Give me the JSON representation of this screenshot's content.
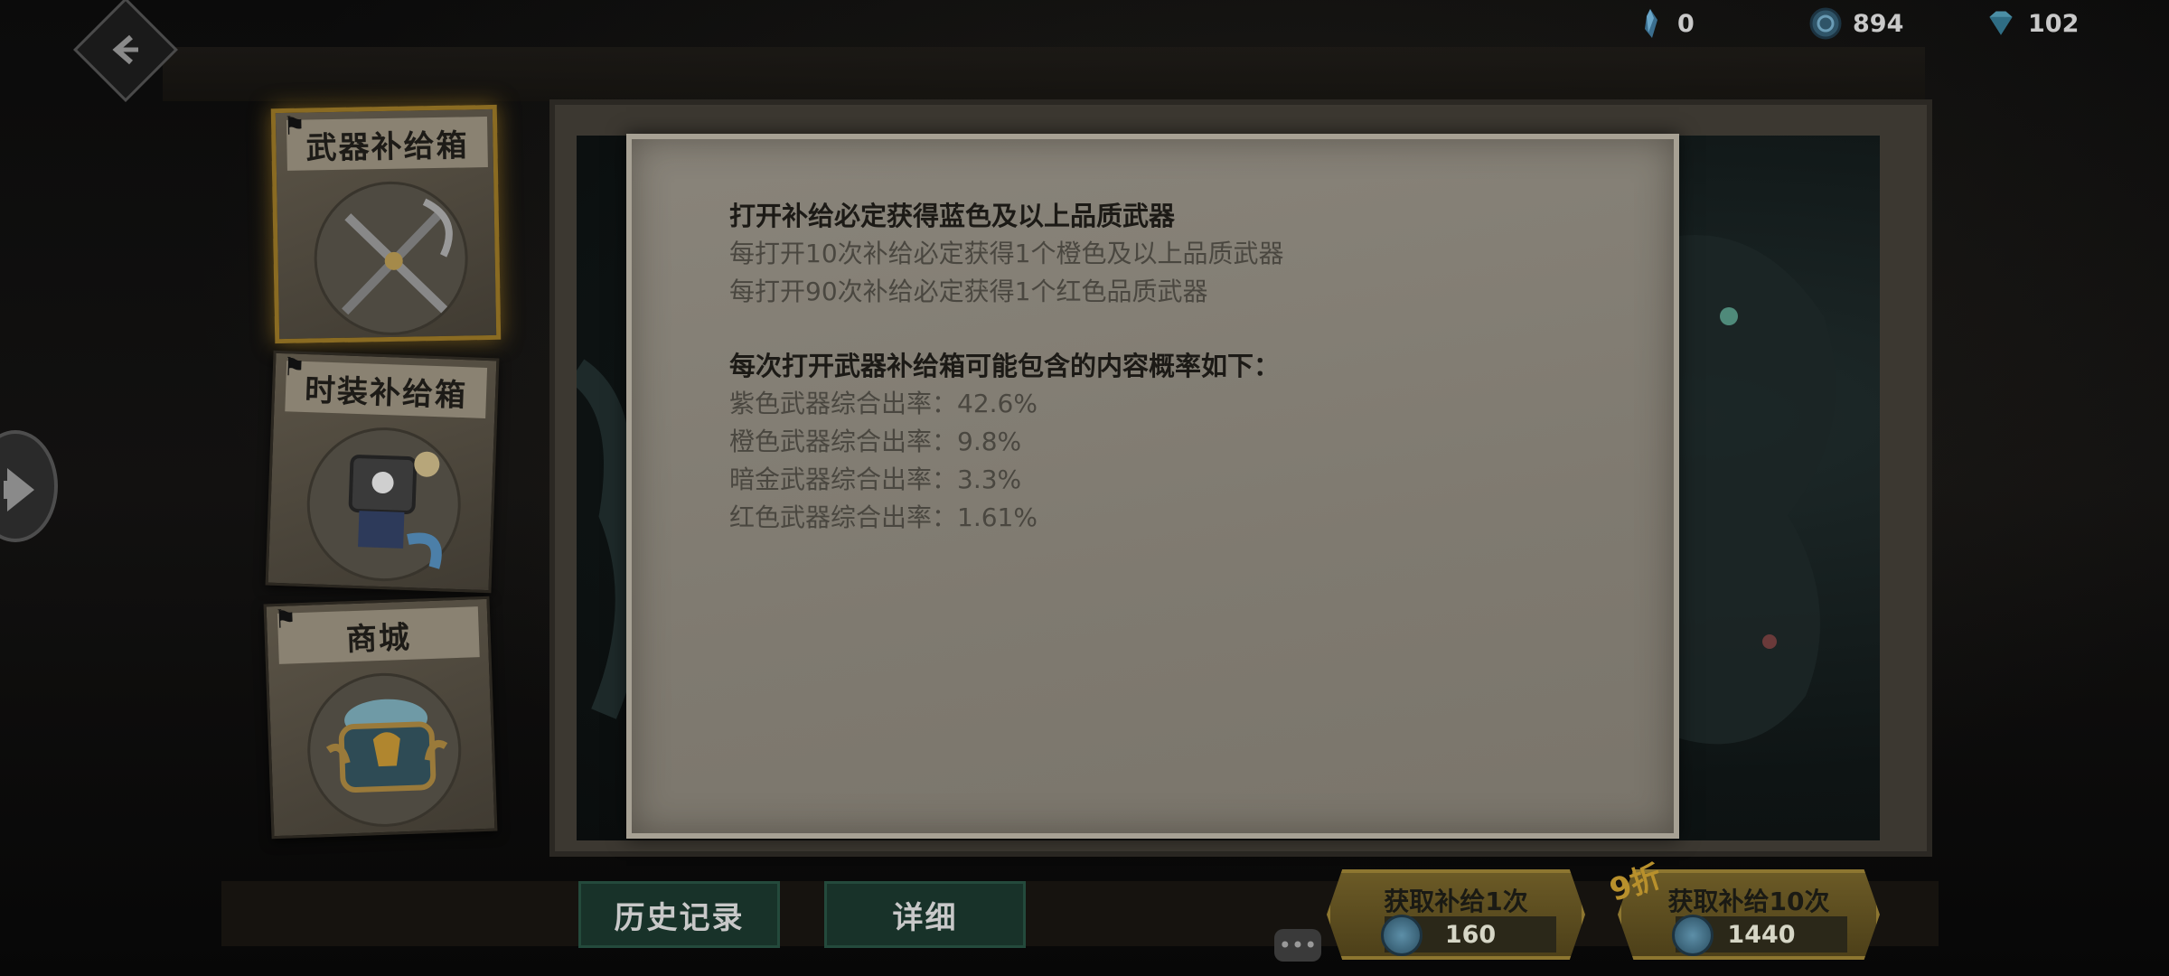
{
  "currencies": [
    {
      "icon": "crystal-shard-icon",
      "value": "0"
    },
    {
      "icon": "blue-coin-icon",
      "value": "894"
    },
    {
      "icon": "diamond-icon",
      "value": "102"
    }
  ],
  "sidebar": {
    "items": [
      {
        "label": "武器补给箱",
        "active": true
      },
      {
        "label": "时装补给箱",
        "active": false
      },
      {
        "label": "商城",
        "active": false
      }
    ]
  },
  "info": {
    "heading1": "打开补给必定获得蓝色及以上品质武器",
    "line1": "每打开10次补给必定获得1个橙色及以上品质武器",
    "line2": "每打开90次补给必定获得1个红色品质武器",
    "heading2": "每次打开武器补给箱可能包含的内容概率如下：",
    "rates": [
      "紫色武器综合出率：42.6%",
      "橙色武器综合出率：9.8%",
      "暗金武器综合出率：3.3%",
      "红色武器综合出率：1.61%"
    ]
  },
  "buttons": {
    "history": "历史记录",
    "details": "详细",
    "draw_one": {
      "label": "获取补给1次",
      "cost": "160"
    },
    "draw_ten": {
      "label": "获取补给10次",
      "cost": "1440",
      "badge": "9折"
    }
  },
  "colors": {
    "paper": "#89847a",
    "dark_button": "#183229",
    "gold_button": "#6b5a26",
    "active_border": "#8a6b22"
  }
}
